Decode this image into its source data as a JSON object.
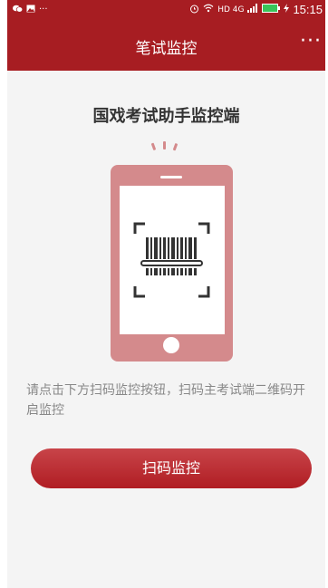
{
  "status_bar": {
    "signal_text": "HD 4G",
    "time": "15:15"
  },
  "app_bar": {
    "title": "笔试监控",
    "more_label": "···"
  },
  "main": {
    "heading": "国戏考试助手监控端",
    "instruction": "请点击下方扫码监控按钮，扫码主考试端二维码开启监控",
    "scan_button_label": "扫码监控"
  },
  "colors": {
    "brand": "#a71d22",
    "phone_illustration": "#d48a8c"
  }
}
